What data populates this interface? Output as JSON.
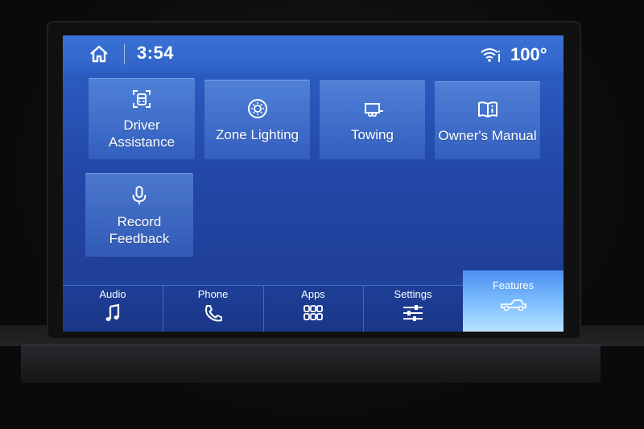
{
  "status_bar": {
    "time": "3:54",
    "temperature": "100°",
    "home_icon": "home-icon",
    "wifi_icon": "wifi-icon"
  },
  "tiles": [
    {
      "label": "Driver\nAssistance",
      "icon": "driver-assist-icon"
    },
    {
      "label": "Zone Lighting",
      "icon": "zone-lighting-icon"
    },
    {
      "label": "Towing",
      "icon": "trailer-icon"
    },
    {
      "label": "Owner's Manual",
      "icon": "manual-book-icon"
    },
    {
      "label": "Record\nFeedback",
      "icon": "microphone-icon"
    }
  ],
  "nav": [
    {
      "label": "Audio",
      "icon": "music-note-icon"
    },
    {
      "label": "Phone",
      "icon": "phone-icon"
    },
    {
      "label": "Apps",
      "icon": "apps-grid-icon"
    },
    {
      "label": "Settings",
      "icon": "sliders-icon"
    },
    {
      "label": "Features",
      "icon": "truck-icon",
      "active": true
    }
  ],
  "colors": {
    "screen_blue": "#2348a8",
    "active_tab": "#7fc0ff"
  }
}
